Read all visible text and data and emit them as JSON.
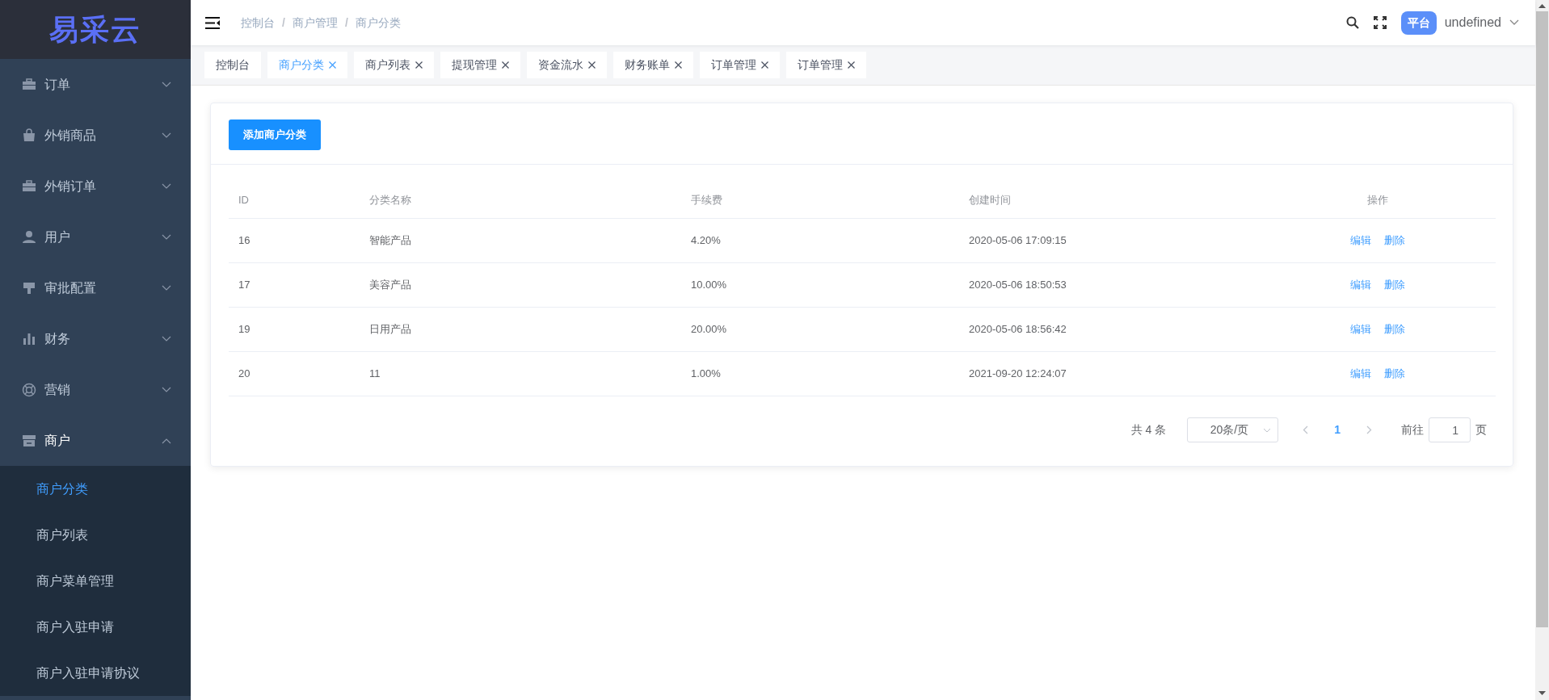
{
  "sidebar": {
    "logo": "易采云",
    "items": [
      {
        "label": "订单",
        "expanded": false
      },
      {
        "label": "外销商品",
        "expanded": false
      },
      {
        "label": "外销订单",
        "expanded": false
      },
      {
        "label": "用户",
        "expanded": false
      },
      {
        "label": "审批配置",
        "expanded": false
      },
      {
        "label": "财务",
        "expanded": false
      },
      {
        "label": "营销",
        "expanded": false
      },
      {
        "label": "商户",
        "expanded": true,
        "children": [
          {
            "label": "商户分类",
            "selected": true
          },
          {
            "label": "商户列表",
            "selected": false
          },
          {
            "label": "商户菜单管理",
            "selected": false
          },
          {
            "label": "商户入驻申请",
            "selected": false
          },
          {
            "label": "商户入驻申请协议",
            "selected": false
          }
        ]
      }
    ]
  },
  "header": {
    "breadcrumb": [
      {
        "label": "控制台",
        "separator": "/"
      },
      {
        "label": "商户管理",
        "separator": "/"
      },
      {
        "label": "商户分类"
      }
    ],
    "role_badge": "平台",
    "user": "undefined"
  },
  "tabs": [
    {
      "label": "控制台",
      "selected": false,
      "closable": false
    },
    {
      "label": "商户分类",
      "selected": true,
      "closable": true
    },
    {
      "label": "商户列表",
      "selected": false,
      "closable": true
    },
    {
      "label": "提现管理",
      "selected": false,
      "closable": true
    },
    {
      "label": "资金流水",
      "selected": false,
      "closable": true
    },
    {
      "label": "财务账单",
      "selected": false,
      "closable": true
    },
    {
      "label": "订单管理",
      "selected": false,
      "closable": true
    },
    {
      "label": "订单管理",
      "selected": false,
      "closable": true
    }
  ],
  "add_button": "添加商户分类",
  "table": {
    "columns": [
      "ID",
      "分类名称",
      "手续费",
      "创建时间",
      "操作"
    ],
    "rows": [
      {
        "id": "16",
        "name": "智能产品",
        "fee": "4.20%",
        "created": "2020-05-06 17:09:15",
        "actions": [
          "编辑",
          "删除"
        ]
      },
      {
        "id": "17",
        "name": "美容产品",
        "fee": "10.00%",
        "created": "2020-05-06 18:50:53",
        "actions": [
          "编辑",
          "删除"
        ]
      },
      {
        "id": "19",
        "name": "日用产品",
        "fee": "20.00%",
        "created": "2020-05-06 18:56:42",
        "actions": [
          "编辑",
          "删除"
        ]
      },
      {
        "id": "20",
        "name": "11",
        "fee": "1.00%",
        "created": "2021-09-20 12:24:07",
        "actions": [
          "编辑",
          "删除"
        ]
      }
    ]
  },
  "pagination": {
    "total": "共 4 条",
    "page_size": "20条/页",
    "pages": [
      {
        "label": "1",
        "selected": true
      }
    ],
    "goto_label": "前往",
    "goto_value": "1",
    "goto_suffix": "页"
  }
}
